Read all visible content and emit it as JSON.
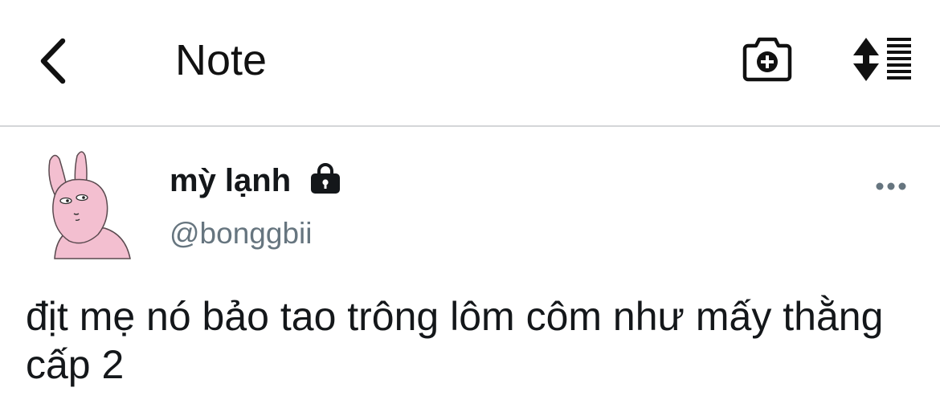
{
  "navbar": {
    "title": "Note",
    "back_icon": "chevron-left-icon",
    "camera_icon": "camera-plus-icon",
    "sort_icon": "sort-list-icon"
  },
  "post": {
    "display_name": "mỳ lạnh",
    "handle": "@bonggbii",
    "protected_icon": "lock-icon",
    "more_icon": "more-horizontal-icon",
    "text": "địt mẹ nó bảo tao trông lôm côm như mấy thằng cấp 2",
    "avatar": "pink-rabbit-avatar"
  },
  "colors": {
    "text": "#14171a",
    "secondary_text": "#66757f",
    "divider": "#d4d6d8",
    "avatar_pink": "#f3bfd0"
  }
}
